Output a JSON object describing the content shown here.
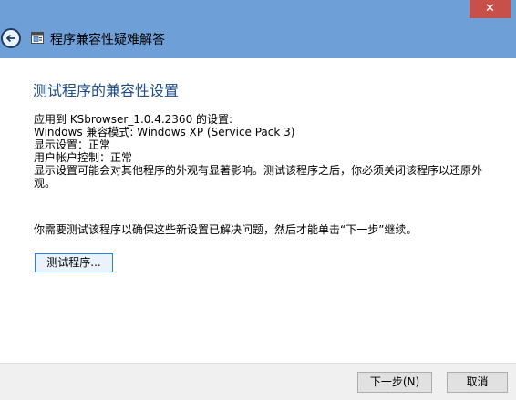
{
  "window": {
    "title": "程序兼容性疑难解答",
    "close_glyph": "✕"
  },
  "main": {
    "heading": "测试程序的兼容性设置",
    "info_lines": [
      "应用到  KSbrowser_1.0.4.2360 的设置:",
      "Windows 兼容模式: Windows XP (Service Pack 3)",
      "显示设置：正常",
      "用户帐户控制：正常",
      "显示设置可能会对其他程序的外观有显著影响。测试该程序之后，你必须关闭该程序以还原外观。"
    ],
    "instruction": "你需要测试该程序以确保这些新设置已解决问题，然后才能单击“下一步”继续。",
    "test_button": "测试程序..."
  },
  "footer": {
    "next_button": "下一步(N)",
    "cancel_button": "取消"
  },
  "colors": {
    "titlebar": "#6e9fd6",
    "heading": "#1e4d8b",
    "close": "#c7504a"
  }
}
